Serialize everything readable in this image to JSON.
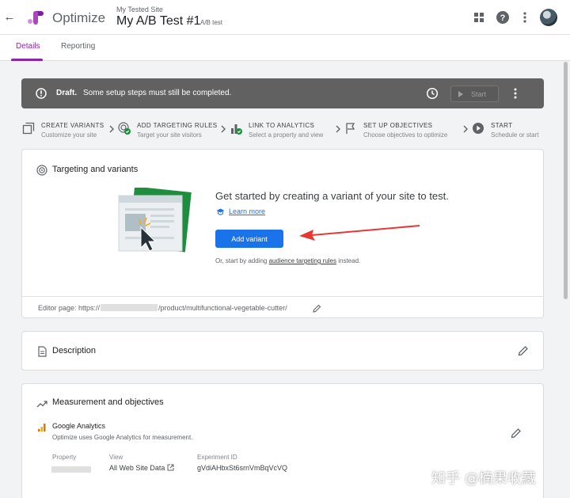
{
  "header": {
    "back_icon": "arrow-left-icon",
    "logo_icon": "optimize-logo",
    "app_name": "Optimize",
    "site_name": "My Tested Site",
    "experiment_name": "My A/B Test #1",
    "experiment_type": "A/B test",
    "icons": [
      "apps-grid-icon",
      "help-icon",
      "more-vert-icon",
      "avatar"
    ]
  },
  "tabs": [
    {
      "label": "Details",
      "active": true
    },
    {
      "label": "Reporting",
      "active": false
    }
  ],
  "banner": {
    "status": "Draft.",
    "message": "Some setup steps must still be completed.",
    "start_label": "Start",
    "background": "#616161"
  },
  "steps": [
    {
      "title": "CREATE VARIANTS",
      "subtitle": "Customize your site",
      "icon": "variants-icon"
    },
    {
      "title": "ADD TARGETING RULES",
      "subtitle": "Target your site visitors",
      "icon": "targeting-check-icon"
    },
    {
      "title": "LINK TO ANALYTICS",
      "subtitle": "Select a property and view",
      "icon": "analytics-check-icon"
    },
    {
      "title": "SET UP OBJECTIVES",
      "subtitle": "Choose objectives to optimize",
      "icon": "flag-icon"
    },
    {
      "title": "START",
      "subtitle": "Schedule or start",
      "icon": "play-circle-icon"
    }
  ],
  "targeting": {
    "title": "Targeting and variants",
    "headline": "Get started by creating a variant of your site to test.",
    "learn_more": "Learn more",
    "add_variant": "Add variant",
    "alt_prefix": "Or, start by adding",
    "alt_link": "audience targeting rules",
    "alt_suffix": "instead.",
    "editor_prefix": "Editor page: https://",
    "editor_suffix": "/product/multifunctional-vegetable-cutter/"
  },
  "description": {
    "title": "Description"
  },
  "measurement": {
    "title": "Measurement and objectives",
    "ga_title": "Google Analytics",
    "ga_subtitle": "Optimize uses Google Analytics for measurement.",
    "property_label": "Property",
    "view_label": "View",
    "view_value": "All Web Site Data",
    "experiment_id_label": "Experiment ID",
    "experiment_id_value": "gVdiAHbxSt6srnVmBqVcVQ"
  },
  "watermark": "知乎 @楠果收藏",
  "colors": {
    "accent_purple": "#8e24aa",
    "primary_blue": "#1a73e8",
    "success_green": "#1e8e3e",
    "annotation_red": "#e53935"
  }
}
